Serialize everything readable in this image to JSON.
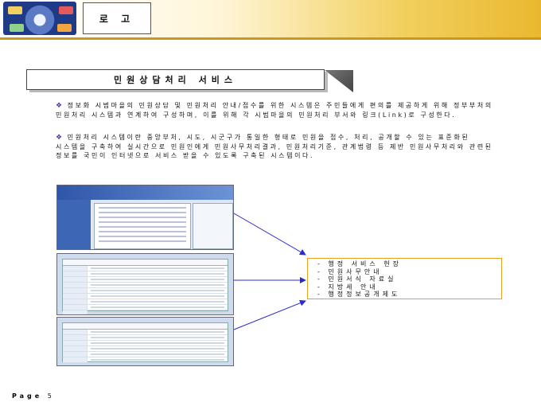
{
  "header": {
    "logo_label": "로 고"
  },
  "title": "민원상담처리 서비스",
  "paragraphs": [
    {
      "bullet": "❖",
      "text": "정보화 시범마을의 민원상담 및 민원처리 안내/접수를 위한 시스템은 주민들에게 편의를 제공하게 위해 정부부처의 민원처리 시스템과 연계하여 구성하며, 이를 위해 각 시범마을의 민원처리 부서와 링크(Link)로 구성한다."
    },
    {
      "bullet": "❖",
      "text": "민원처리 시스템이란 중앙부처, 시도, 시군구가 통일한 형태로 민원을 접수, 처리, 공개할 수 있는 표준화된 시스템을 구축하여 실시간으로 민원인에게 민원사무처리결과, 민원처리기준, 관계법령 등 제반 민원사무처리와 관련된 정보를 국민이 인터넷으로 서비스 받을 수 있도록 구축된 시스템이다."
    }
  ],
  "services": [
    "- 행정 서비스 헌장",
    "- 민원사무안내",
    "- 민원서식 자료실",
    "- 지방세 안내",
    "- 행정정보공개제도"
  ],
  "colors": {
    "accent_gold": "#c79a18",
    "info_border": "#e8a020",
    "arrow": "#2b2bd0",
    "bullet": "#4a3aa8"
  },
  "footer": {
    "page_word": "Page",
    "page_number": "5"
  }
}
